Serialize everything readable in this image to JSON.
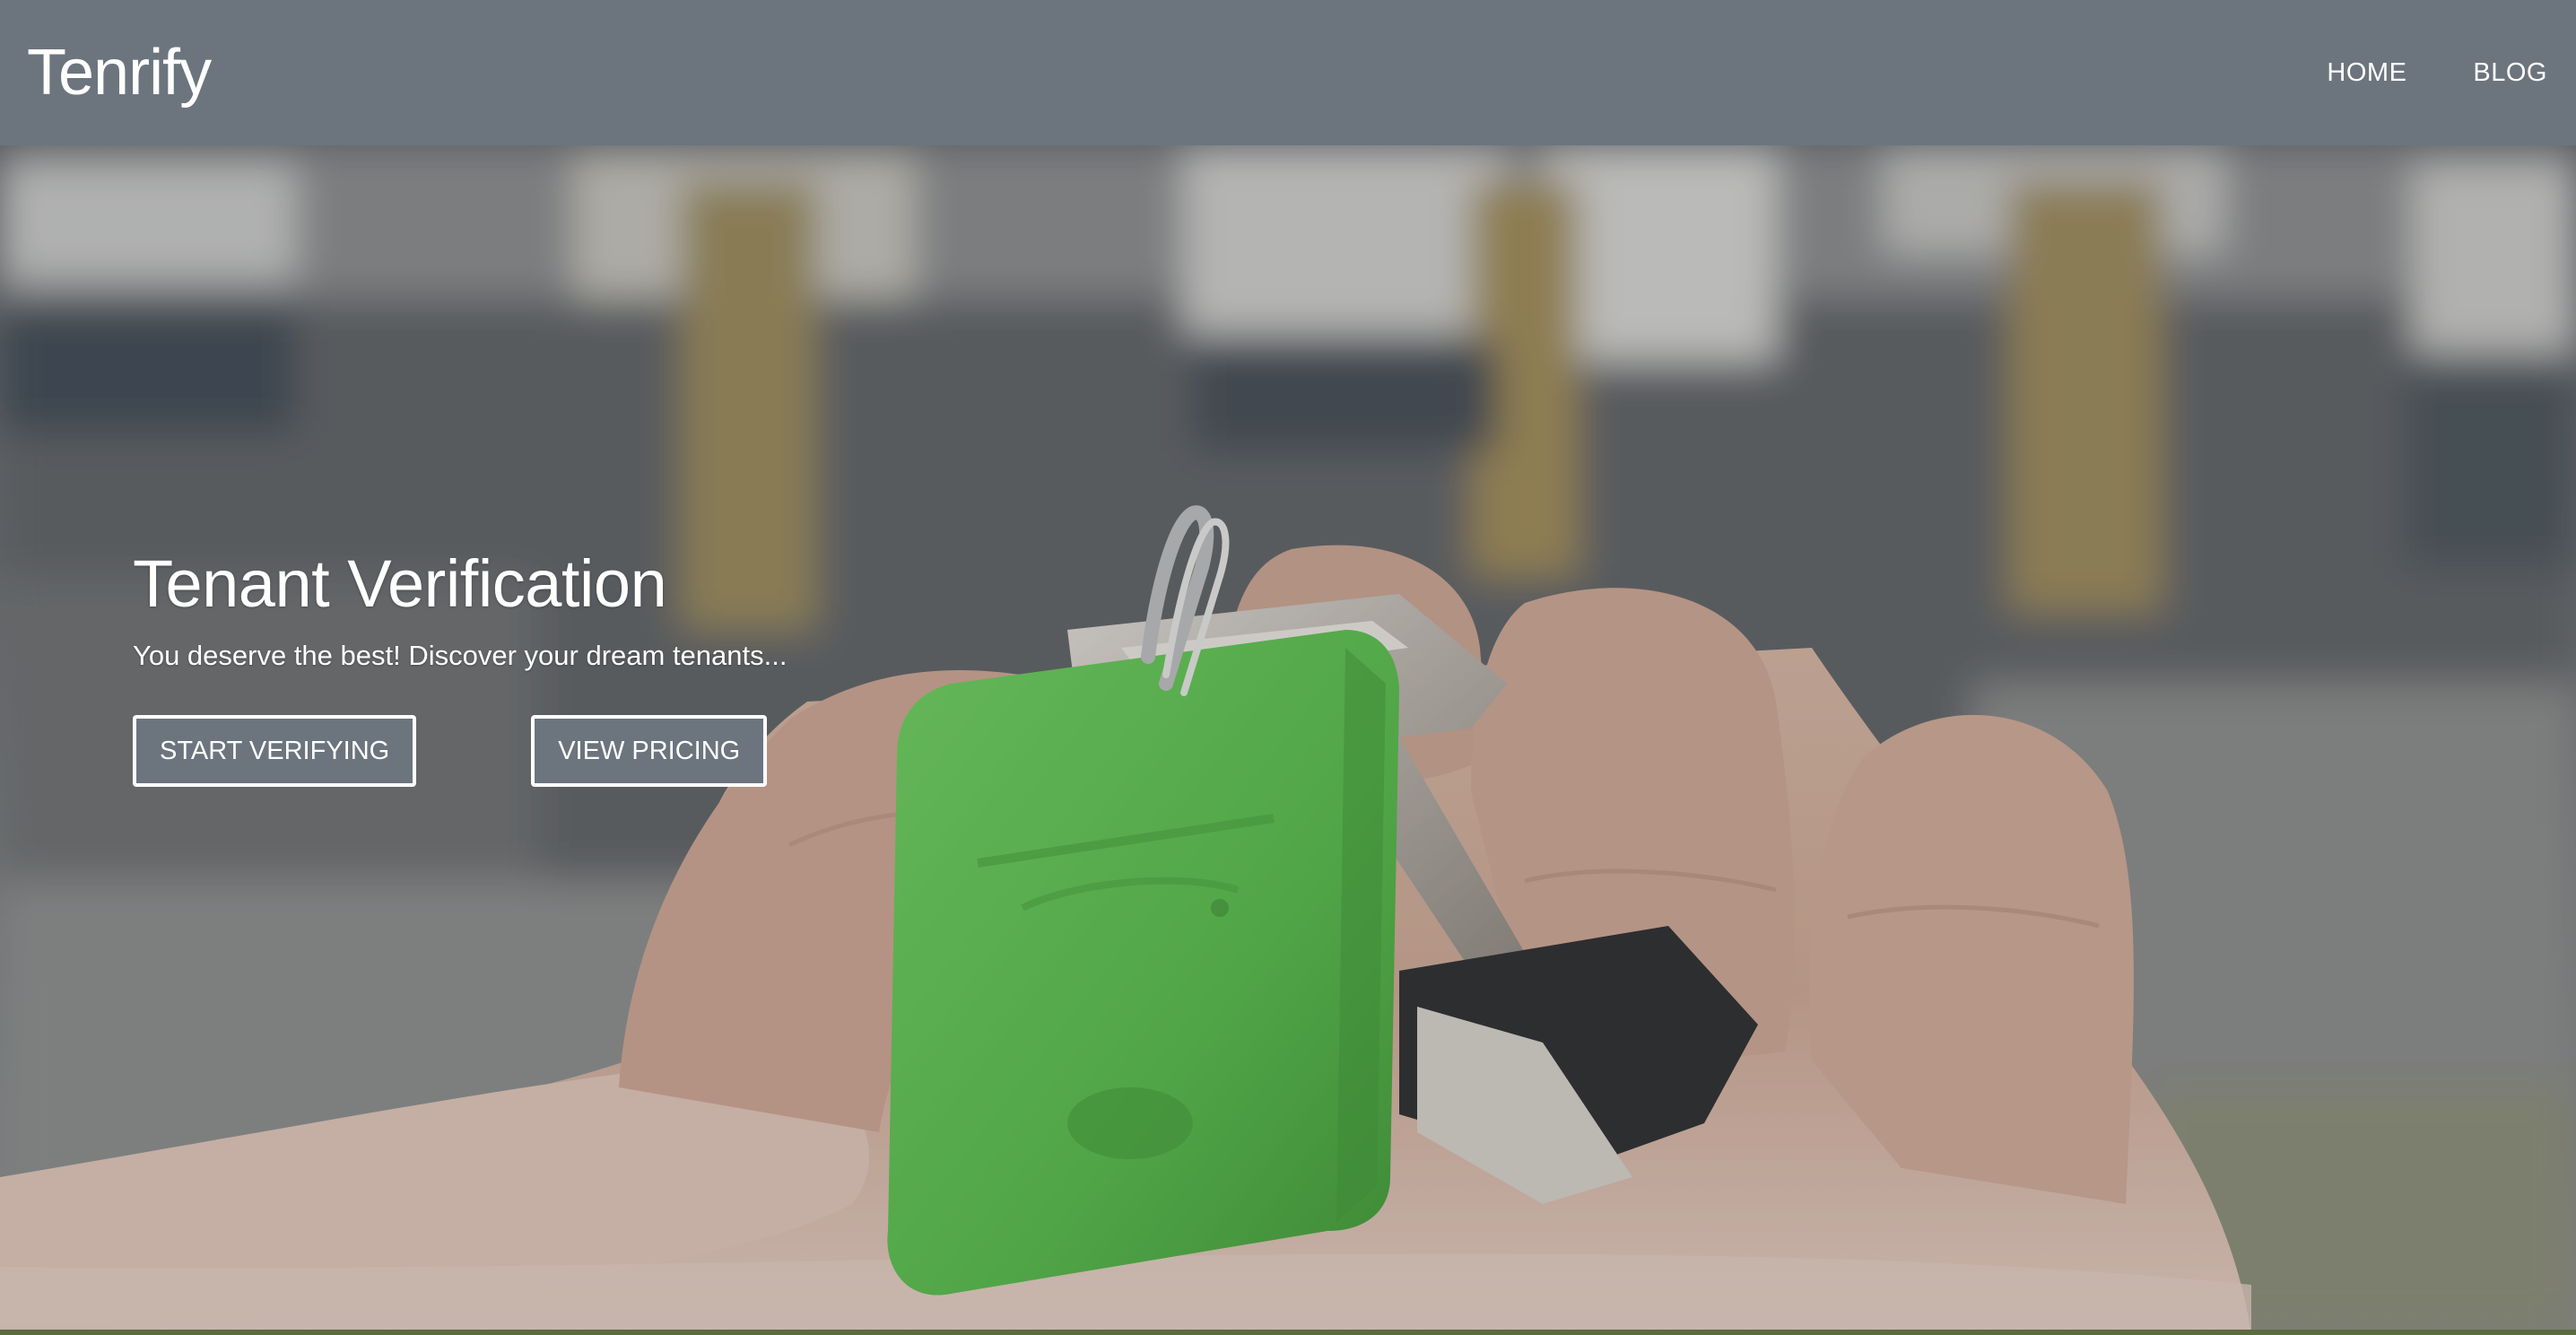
{
  "navbar": {
    "brand": "Tenrify",
    "links": [
      {
        "label": "HOME"
      },
      {
        "label": "BLOG"
      }
    ]
  },
  "hero": {
    "title": "Tenant Verification",
    "subtitle": "You deserve the best! Discover your dream tenants...",
    "buttons": {
      "primary": "START VERIFYING",
      "secondary": "VIEW PRICING"
    },
    "image_description_icon": "hand-holding-keys-image"
  },
  "colors": {
    "navbar_bg": "#6c757d",
    "button_bg": "#6c757d",
    "button_border": "#ffffff",
    "text": "#ffffff",
    "keyfob_green": "#5cc24e"
  }
}
